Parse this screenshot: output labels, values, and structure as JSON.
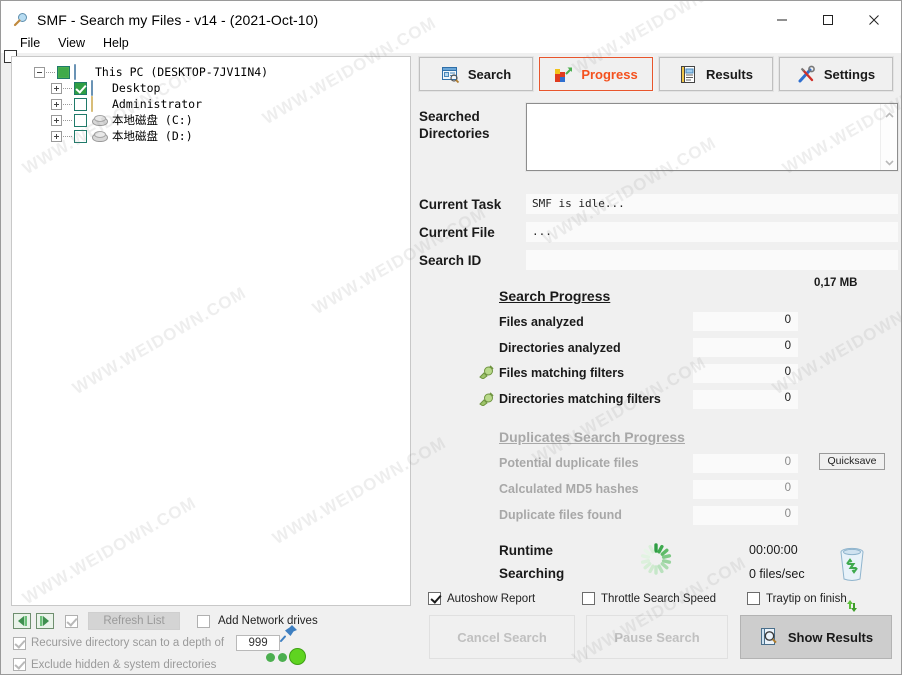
{
  "window": {
    "title": "SMF - Search my Files - v14 - (2021-Oct-10)",
    "icon": "magnifier-icon",
    "minimize_label": "–",
    "maximize_label": "□",
    "close_label": "✕"
  },
  "menubar": {
    "items": [
      "File",
      "View",
      "Help"
    ]
  },
  "tree": {
    "nodes": [
      {
        "label": "This PC (DESKTOP-7JV1IN4)",
        "icon": "monitor-icon",
        "expander": "minus",
        "check": "full",
        "indent": 0
      },
      {
        "label": "Desktop",
        "icon": "monitor-icon",
        "expander": "plus",
        "check": "checked",
        "indent": 1
      },
      {
        "label": "Administrator",
        "icon": "folder-icon",
        "expander": "plus",
        "check": "empty",
        "indent": 1
      },
      {
        "label": "本地磁盘 (C:)",
        "icon": "disk-icon",
        "expander": "plus",
        "check": "empty",
        "indent": 1
      },
      {
        "label": "本地磁盘 (D:)",
        "icon": "disk-icon",
        "expander": "plus",
        "check": "empty",
        "indent": 1
      }
    ]
  },
  "left_options": {
    "collapse_all_icon": "collapse-left-icon",
    "expand_all_icon": "expand-right-icon",
    "refresh_checkbox_checked": true,
    "refresh_label": "Refresh List",
    "add_network_label": "Add Network drives",
    "add_network_checked": false,
    "recursive_label": "Recursive directory scan to a depth of",
    "recursive_checked": true,
    "depth_value": "999",
    "exclude_label": "Exclude hidden & system directories",
    "exclude_checked": true,
    "pin_icon": "pushpin-icon",
    "status_dots": [
      "#4caf50",
      "#4caf50",
      "#58d020"
    ]
  },
  "tabs": [
    {
      "label": "Search",
      "icon": "search-window-icon",
      "active": false
    },
    {
      "label": "Progress",
      "icon": "progress-chart-icon",
      "active": true
    },
    {
      "label": "Results",
      "icon": "notebook-icon",
      "active": false
    },
    {
      "label": "Settings",
      "icon": "tools-icon",
      "active": false
    }
  ],
  "progress": {
    "searched_directories_label": "Searched\nDirectories",
    "searched_directories_value": "",
    "current_task_label": "Current Task",
    "current_task_value": "SMF is idle...",
    "current_file_label": "Current File",
    "current_file_value": "...",
    "search_id_label": "Search ID",
    "search_id_value": "",
    "memory_usage": "0,17 MB",
    "search_progress_title": "Search Progress",
    "search_rows": [
      {
        "label": "Files analyzed",
        "value": "0",
        "icon": null
      },
      {
        "label": "Directories analyzed",
        "value": "0",
        "icon": null
      },
      {
        "label": "Files matching filters",
        "value": "0",
        "icon": "plug-icon"
      },
      {
        "label": "Directories matching filters",
        "value": "0",
        "icon": "plug-icon"
      }
    ],
    "duplicates_title": "Duplicates Search Progress",
    "duplicate_rows": [
      {
        "label": "Potential duplicate files",
        "value": "0"
      },
      {
        "label": "Calculated MD5 hashes",
        "value": "0"
      },
      {
        "label": "Duplicate files found",
        "value": "0"
      }
    ],
    "quicksave_label": "Quicksave",
    "runtime_label": "Runtime",
    "searching_label": "Searching",
    "runtime_value": "00:00:00",
    "speed_value": "0 files/sec",
    "spinner_icon": "loading-spinner-icon",
    "recyclebin_icon": "recycle-bin-icon",
    "recycle_small_icon": "recycle-arrows-icon"
  },
  "footer_checkboxes": [
    {
      "label": "Autoshow Report",
      "checked": true
    },
    {
      "label": "Throttle Search Speed",
      "checked": false
    },
    {
      "label": "Traytip on finish",
      "checked": false
    }
  ],
  "action_buttons": [
    {
      "label": "Cancel Search",
      "enabled": false,
      "icon": null
    },
    {
      "label": "Pause Search",
      "enabled": false,
      "icon": null
    },
    {
      "label": "Show Results",
      "enabled": true,
      "icon": "results-icon"
    }
  ],
  "colors": {
    "accent_active_tab": "#f4511e",
    "window_bg": "#f0f0f0",
    "panel_bg": "#ffffff",
    "disabled_text": "#a8a8a8"
  },
  "watermark_text": "WWW.WEIDOWN.COM"
}
